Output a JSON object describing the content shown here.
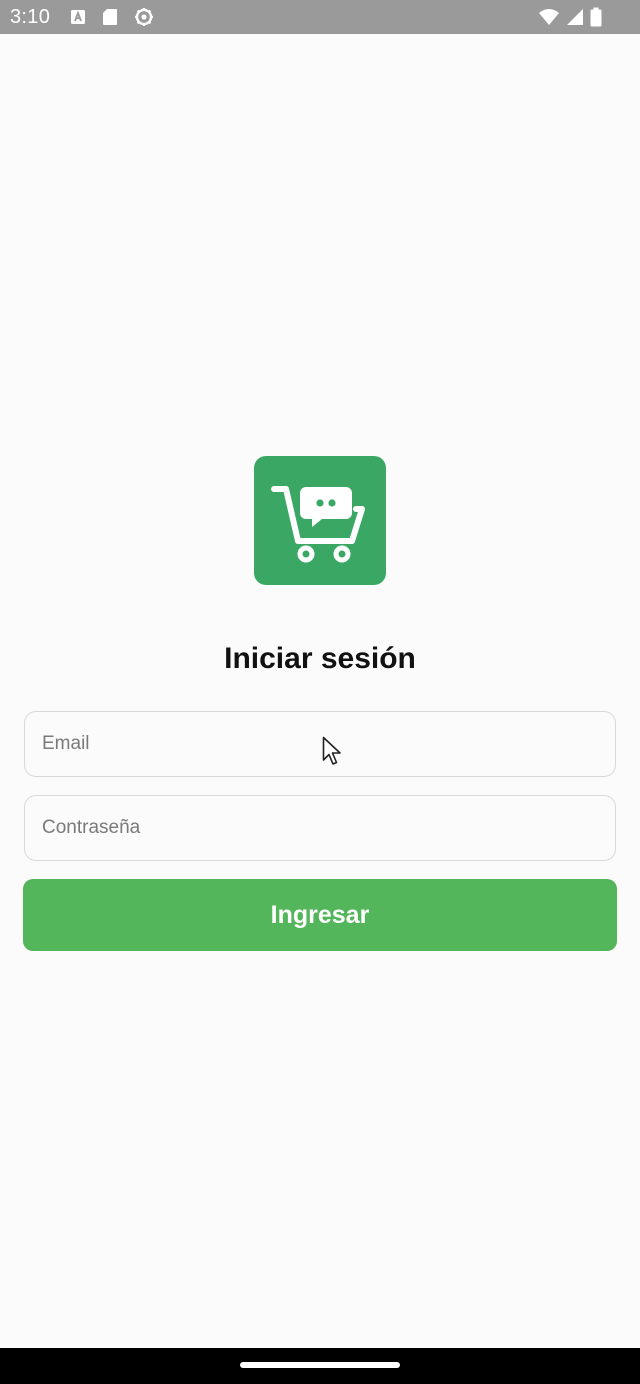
{
  "status_bar": {
    "time": "3:10",
    "left_icons": [
      "a-notification-icon",
      "sd-card-icon",
      "settings-gear-icon"
    ],
    "right_icons": [
      "wifi-icon",
      "signal-icon",
      "battery-icon"
    ]
  },
  "login": {
    "logo_icon": "shopping-cart-chat-icon",
    "title": "Iniciar sesión",
    "email": {
      "placeholder": "Email",
      "value": ""
    },
    "password": {
      "placeholder": "Contraseña",
      "value": ""
    },
    "submit_label": "Ingresar"
  },
  "colors": {
    "logo_background": "#3aa864",
    "button_background": "#53b65a",
    "status_bar": "#9a9a9a",
    "background": "#fbfbfb"
  }
}
